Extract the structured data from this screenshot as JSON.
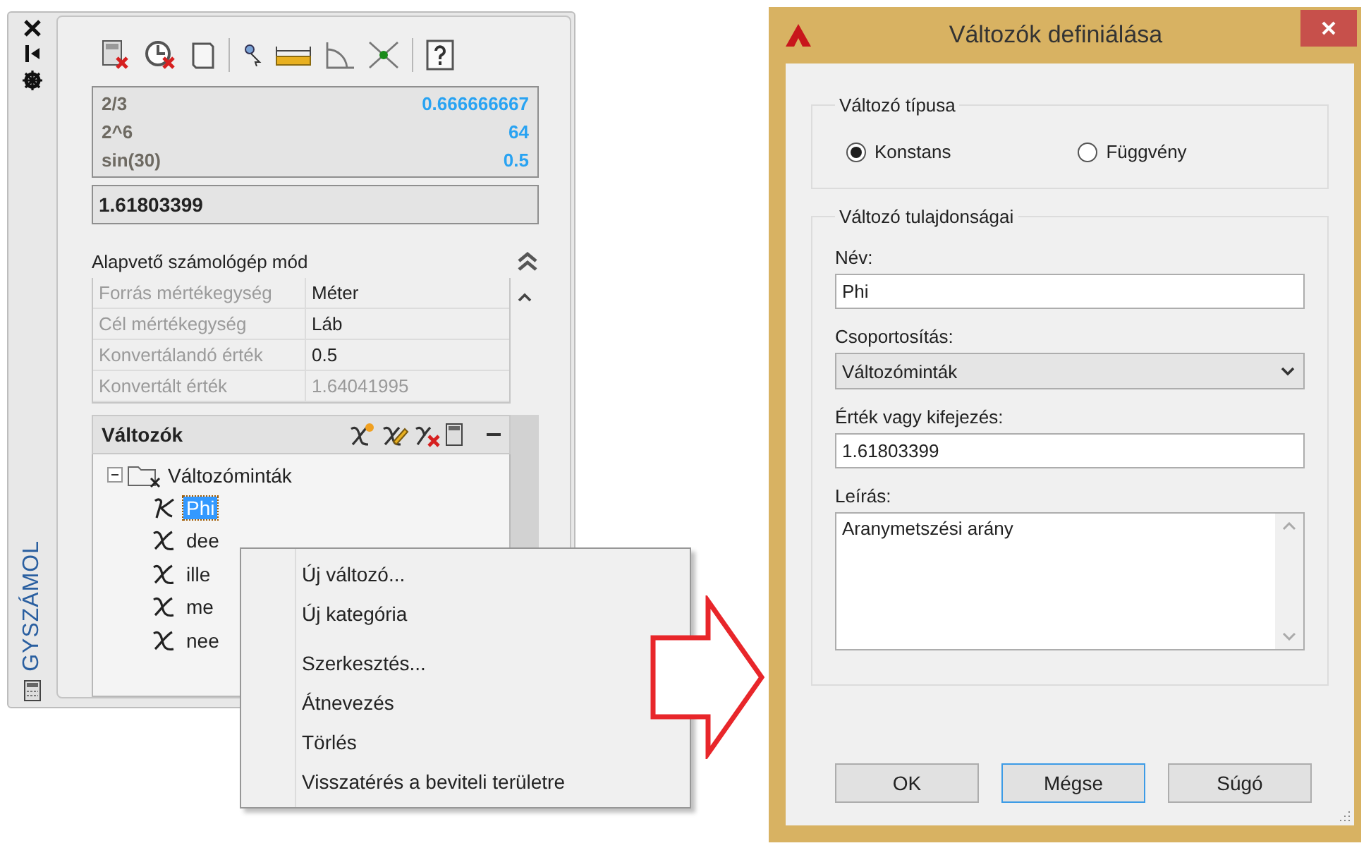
{
  "palette": {
    "side_title": "GYSZÁMOL",
    "history": [
      {
        "expression": "2/3",
        "result": "0.666666667"
      },
      {
        "expression": "2^6",
        "result": "64"
      },
      {
        "expression": "sin(30)",
        "result": "0.5"
      }
    ],
    "input": "1.61803399",
    "mode_title": "Alapvető számológép mód",
    "converter": [
      {
        "label": "Forrás mértékegység",
        "value": "Méter",
        "readonly": false
      },
      {
        "label": "Cél mértékegység",
        "value": "Láb",
        "readonly": false
      },
      {
        "label": "Konvertálandó érték",
        "value": "0.5",
        "readonly": false
      },
      {
        "label": "Konvertált érték",
        "value": "1.64041995",
        "readonly": true
      }
    ],
    "variables": {
      "title": "Változók",
      "tree": [
        {
          "label": "Változóminták",
          "expanded": true,
          "children": [
            {
              "label": "Phi",
              "kind": "constant",
              "selected": true
            },
            {
              "label": "dee",
              "kind": "function",
              "selected": false
            },
            {
              "label": "ille",
              "kind": "function",
              "selected": false
            },
            {
              "label": "me",
              "kind": "function",
              "selected": false
            },
            {
              "label": "nee",
              "kind": "function",
              "selected": false
            }
          ]
        }
      ]
    }
  },
  "context_menu": {
    "groups": [
      {
        "items": [
          "Új változó...",
          "Új kategória"
        ]
      },
      {
        "items": [
          "Szerkesztés...",
          "Átnevezés",
          "Törlés",
          "Visszatérés a beviteli területre"
        ]
      }
    ]
  },
  "dialog": {
    "title": "Változók definiálása",
    "type_group": {
      "title": "Változó típusa",
      "options": [
        {
          "label": "Konstans",
          "selected": true
        },
        {
          "label": "Függvény",
          "selected": false
        }
      ]
    },
    "props_group": {
      "title": "Változó tulajdonságai",
      "fields": [
        {
          "label": "Név:",
          "kind": "text",
          "value": "Phi"
        },
        {
          "label": "Csoportosítás:",
          "kind": "select",
          "value": "Változóminták"
        },
        {
          "label": "Érték vagy kifejezés:",
          "kind": "text",
          "value": "1.61803399"
        },
        {
          "label": "Leírás:",
          "kind": "textarea",
          "value": "Aranymetszési arány"
        }
      ]
    },
    "buttons": [
      {
        "label": "OK",
        "focused": false
      },
      {
        "label": "Mégse",
        "focused": true
      },
      {
        "label": "Súgó",
        "focused": false
      }
    ]
  }
}
